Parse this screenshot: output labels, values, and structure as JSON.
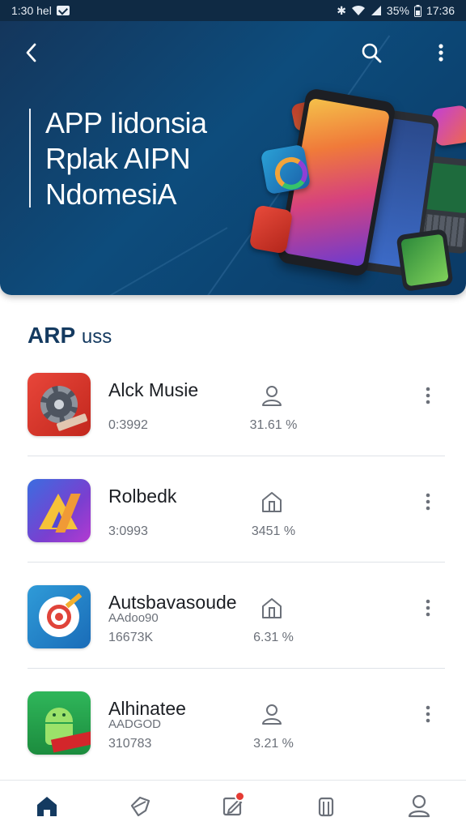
{
  "status_bar": {
    "left_text": "1:30 hel",
    "battery": "35%",
    "time": "17:36"
  },
  "header": {
    "title_lines": [
      "APP Iidonsia",
      "Rplak AIPN",
      "NdomesiA"
    ]
  },
  "section": {
    "title_bold": "ARP",
    "title_light": "uss"
  },
  "apps": [
    {
      "name": "Alck Musie",
      "subtitle": "",
      "size": "0:3992",
      "percent": "31.61 %",
      "action_icon": "person-icon"
    },
    {
      "name": "Rolbedk",
      "subtitle": "",
      "size": "3:0993",
      "percent": "3451 %",
      "action_icon": "home-icon"
    },
    {
      "name": "Autsbavasoude",
      "subtitle": "AAdoo90",
      "size": "16673K",
      "percent": "6.31 %",
      "action_icon": "home-icon"
    },
    {
      "name": "Alhinatee",
      "subtitle": "AADGOD",
      "size": "310783",
      "percent": "3.21 %",
      "action_icon": "person-icon"
    }
  ],
  "bottom_nav": [
    {
      "icon": "home-icon",
      "active": true
    },
    {
      "icon": "tag-icon",
      "active": false
    },
    {
      "icon": "edit-icon",
      "active": false,
      "badge": true
    },
    {
      "icon": "library-icon",
      "active": false
    },
    {
      "icon": "profile-icon",
      "active": false
    }
  ],
  "colors": {
    "header_bg": "#0d4c7c",
    "accent": "#143a60",
    "badge": "#e53b34"
  }
}
